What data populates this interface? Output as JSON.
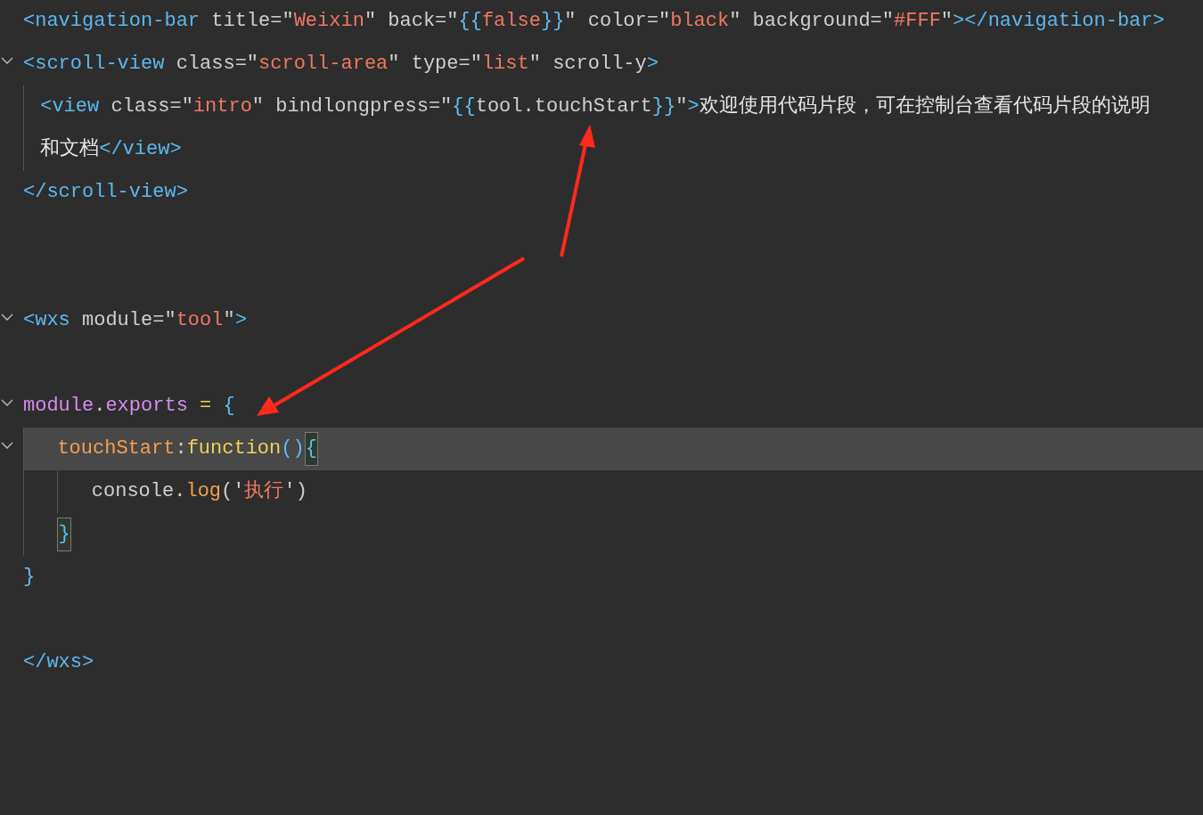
{
  "editor": {
    "lines": [
      {
        "kind": "code",
        "selected": false,
        "tokens": [
          {
            "kind": "tag",
            "text": "<navigation-bar"
          },
          {
            "kind": "attr",
            "text": " title="
          },
          {
            "kind": "punct",
            "text": "\""
          },
          {
            "kind": "string",
            "text": "Weixin"
          },
          {
            "kind": "punct",
            "text": "\""
          },
          {
            "kind": "attr",
            "text": " back="
          },
          {
            "kind": "punct",
            "text": "\""
          },
          {
            "kind": "brace",
            "text": "{{"
          },
          {
            "kind": "string",
            "text": "false"
          },
          {
            "kind": "brace",
            "text": "}}"
          },
          {
            "kind": "punct",
            "text": "\""
          },
          {
            "kind": "attr",
            "text": " color="
          },
          {
            "kind": "punct",
            "text": "\""
          },
          {
            "kind": "string",
            "text": "black"
          },
          {
            "kind": "punct",
            "text": "\""
          },
          {
            "kind": "attr",
            "text": " background="
          },
          {
            "kind": "punct",
            "text": "\""
          },
          {
            "kind": "string",
            "text": "#FFF"
          },
          {
            "kind": "punct",
            "text": "\""
          },
          {
            "kind": "tag",
            "text": "></navigation-bar>"
          }
        ]
      },
      {
        "kind": "code",
        "selected": false,
        "expanded": true,
        "tokens": [
          {
            "kind": "tag",
            "text": "<scroll-view"
          },
          {
            "kind": "attr",
            "text": " class="
          },
          {
            "kind": "punct",
            "text": "\""
          },
          {
            "kind": "string",
            "text": "scroll-area"
          },
          {
            "kind": "punct",
            "text": "\""
          },
          {
            "kind": "attr",
            "text": " type="
          },
          {
            "kind": "punct",
            "text": "\""
          },
          {
            "kind": "string",
            "text": "list"
          },
          {
            "kind": "punct",
            "text": "\""
          },
          {
            "kind": "attr",
            "text": " scroll-y"
          },
          {
            "kind": "tag",
            "text": ">"
          }
        ],
        "children": [
          {
            "kind": "code",
            "selected": false,
            "tokens": [
              {
                "kind": "tag",
                "text": "<view"
              },
              {
                "kind": "attr",
                "text": " class="
              },
              {
                "kind": "punct",
                "text": "\""
              },
              {
                "kind": "string",
                "text": "intro"
              },
              {
                "kind": "punct",
                "text": "\""
              },
              {
                "kind": "attr",
                "text": " bindlongpress="
              },
              {
                "kind": "punct",
                "text": "\""
              },
              {
                "kind": "brace",
                "text": "{{"
              },
              {
                "kind": "plain",
                "text": "tool.touchStart"
              },
              {
                "kind": "brace",
                "text": "}}"
              },
              {
                "kind": "punct",
                "text": "\""
              },
              {
                "kind": "tag",
                "text": ">"
              },
              {
                "kind": "text",
                "text": "欢迎使用代码片段，可在控制台查看代码片段的说明"
              }
            ]
          },
          {
            "kind": "code",
            "selected": false,
            "tokens": [
              {
                "kind": "text",
                "text": "和文档"
              },
              {
                "kind": "tag",
                "text": "</view>"
              }
            ]
          }
        ]
      },
      {
        "kind": "code",
        "selected": false,
        "tokens": [
          {
            "kind": "tag",
            "text": "</scroll-view>"
          }
        ]
      },
      {
        "kind": "blank"
      },
      {
        "kind": "blank"
      },
      {
        "kind": "code",
        "selected": false,
        "expanded": true,
        "tokens": [
          {
            "kind": "tag",
            "text": "<wxs"
          },
          {
            "kind": "attr",
            "text": " module="
          },
          {
            "kind": "punct",
            "text": "\""
          },
          {
            "kind": "string",
            "text": "tool"
          },
          {
            "kind": "punct",
            "text": "\""
          },
          {
            "kind": "tag",
            "text": ">"
          }
        ]
      },
      {
        "kind": "blank"
      },
      {
        "kind": "code",
        "selected": false,
        "expanded": true,
        "tokens": [
          {
            "kind": "module",
            "text": "module"
          },
          {
            "kind": "plain",
            "text": "."
          },
          {
            "kind": "module",
            "text": "exports"
          },
          {
            "kind": "operator",
            "text": " = "
          },
          {
            "kind": "brace",
            "text": "{"
          }
        ],
        "children": [
          {
            "kind": "code",
            "selected": true,
            "expanded": true,
            "tokens": [
              {
                "kind": "property",
                "text": "touchStart"
              },
              {
                "kind": "plain",
                "text": ":"
              },
              {
                "kind": "function",
                "text": "function"
              },
              {
                "kind": "brace",
                "text": "()"
              },
              {
                "kind": "brace",
                "text": "{",
                "matched": true
              }
            ],
            "children": [
              {
                "kind": "code",
                "selected": false,
                "tokens": [
                  {
                    "kind": "plain",
                    "text": "console."
                  },
                  {
                    "kind": "property",
                    "text": "log"
                  },
                  {
                    "kind": "plain",
                    "text": "('"
                  },
                  {
                    "kind": "string",
                    "text": "执行"
                  },
                  {
                    "kind": "plain",
                    "text": "')"
                  }
                ]
              }
            ]
          },
          {
            "kind": "code",
            "selected": false,
            "tokens": [
              {
                "kind": "brace",
                "text": "}",
                "matched": true
              }
            ]
          }
        ]
      },
      {
        "kind": "code",
        "selected": false,
        "tokens": [
          {
            "kind": "brace",
            "text": "}"
          }
        ]
      },
      {
        "kind": "blank"
      },
      {
        "kind": "code",
        "selected": false,
        "tokens": [
          {
            "kind": "tag",
            "text": "</wxs>"
          }
        ]
      }
    ]
  }
}
